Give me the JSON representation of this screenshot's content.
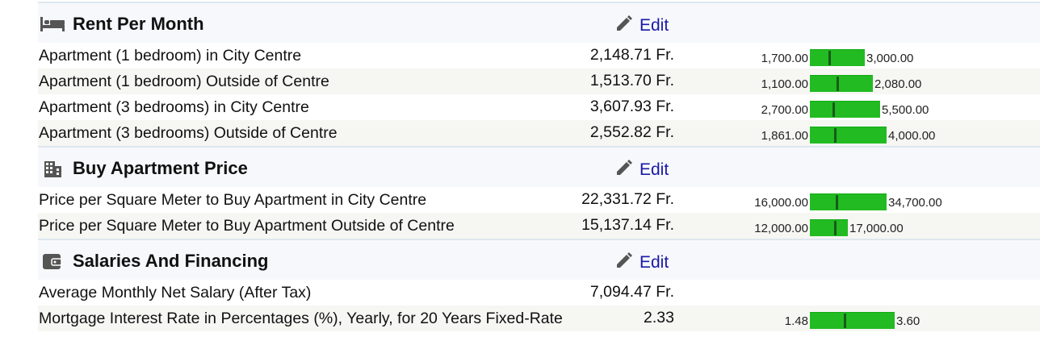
{
  "sections": [
    {
      "title": "Rent Per Month",
      "icon": "bed-icon",
      "edit_label": "Edit",
      "rows": [
        {
          "label": "Apartment (1 bedroom) in City Centre",
          "value": "2,148.71 Fr.",
          "low": "1,700.00",
          "high": "3,000.00",
          "bar_fraction": 0.35,
          "marker": 0.34
        },
        {
          "label": "Apartment (1 bedroom) Outside of Centre",
          "value": "1,513.70 Fr.",
          "low": "1,100.00",
          "high": "2,080.00",
          "bar_fraction": 0.41,
          "marker": 0.42
        },
        {
          "label": "Apartment (3 bedrooms) in City Centre",
          "value": "3,607.93 Fr.",
          "low": "2,700.00",
          "high": "5,500.00",
          "bar_fraction": 0.47,
          "marker": 0.32
        },
        {
          "label": "Apartment (3 bedrooms) Outside of Centre",
          "value": "2,552.82 Fr.",
          "low": "1,861.00",
          "high": "4,000.00",
          "bar_fraction": 0.52,
          "marker": 0.32
        }
      ]
    },
    {
      "title": "Buy Apartment Price",
      "icon": "building-icon",
      "edit_label": "Edit",
      "rows": [
        {
          "label": "Price per Square Meter to Buy Apartment in City Centre",
          "value": "22,331.72 Fr.",
          "low": "16,000.00",
          "high": "34,700.00",
          "bar_fraction": 0.52,
          "marker": 0.34
        },
        {
          "label": "Price per Square Meter to Buy Apartment Outside of Centre",
          "value": "15,137.14 Fr.",
          "low": "12,000.00",
          "high": "17,000.00",
          "bar_fraction": 0.22,
          "marker": 0.63
        }
      ]
    },
    {
      "title": "Salaries And Financing",
      "icon": "wallet-icon",
      "edit_label": "Edit",
      "rows": [
        {
          "label": "Average Monthly Net Salary (After Tax)",
          "value": "7,094.47 Fr.",
          "low": "",
          "high": "",
          "bar_fraction": 0,
          "marker": 0
        },
        {
          "label": "Mortgage Interest Rate in Percentages (%), Yearly, for 20 Years Fixed-Rate",
          "value": "2.33",
          "low": "1.48",
          "high": "3.60",
          "bar_fraction": 0.58,
          "marker": 0.4
        }
      ]
    }
  ],
  "colors": {
    "bar": "#22bb22",
    "marker": "#1a5a1a",
    "edit": "#1a1aa6"
  }
}
